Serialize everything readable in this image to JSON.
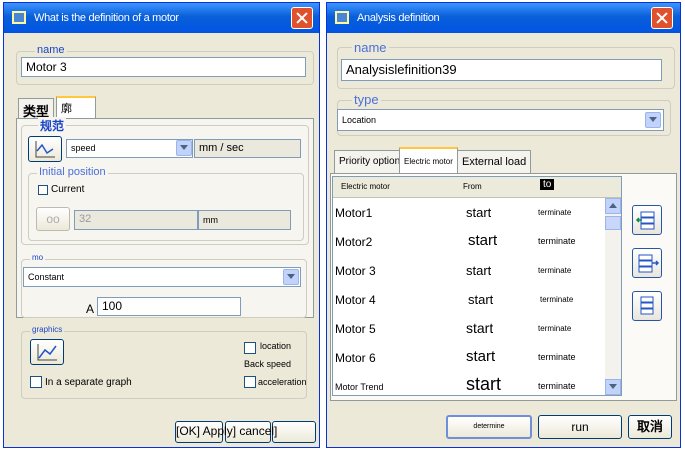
{
  "left": {
    "title": "What is the definition of a motor",
    "name_label": "name",
    "name_value": "Motor 3",
    "tab_type": "类型",
    "tab_profile": "廓",
    "spec_label": "规范",
    "speed_select": "speed",
    "speed_unit": "mm / sec",
    "initial_position_label": "Initial position",
    "current_label": "Current",
    "position_value": "32",
    "position_unit": "mm",
    "model_label": "mo",
    "model_select": "Constant",
    "a_label": "A",
    "a_value": "100",
    "graphics_label": "graphics",
    "location_label": "location",
    "back_speed_label": "Back speed",
    "acceleration_label": "acceleration",
    "separate_graph_label": "In a separate graph",
    "buttons_text": "[OK] Apply] cancel]"
  },
  "right": {
    "title": "Analysis definition",
    "name_label": "name",
    "name_value": "Analysislefinition39",
    "type_label": "type",
    "type_select": "Location",
    "tabs": [
      "Priority options",
      "Electric motor",
      "External load"
    ],
    "columns": [
      "Electric motor",
      "From",
      "to"
    ],
    "rows": [
      {
        "motor": "Motor1",
        "from": "start",
        "to": "terminate"
      },
      {
        "motor": "Motor2",
        "from": "start",
        "to": "terminate"
      },
      {
        "motor": "Motor 3",
        "from": "start",
        "to": "terminate"
      },
      {
        "motor": "Motor 4",
        "from": "start",
        "to": "terminate"
      },
      {
        "motor": "Motor 5",
        "from": "start",
        "to": "terminate"
      },
      {
        "motor": "Motor 6",
        "from": "start",
        "to": "terminate"
      },
      {
        "motor": "Motor Trend",
        "from": "start",
        "to": "terminate"
      }
    ],
    "determine_label": "determine",
    "run_label": "run",
    "cancel_label": "取消"
  },
  "colors": {
    "title_bar": "#0054e3",
    "close_button": "#e0522e",
    "legend_text": "#1a44c8",
    "tab_highlight": "#ffc83c"
  },
  "icons": [
    "window-icon",
    "close-icon",
    "profile-graph-icon",
    "glasses-icon",
    "graph-icon",
    "scroll-up-icon",
    "scroll-down-icon",
    "add-motor-icon",
    "insert-motor-icon",
    "delete-motor-icon"
  ]
}
